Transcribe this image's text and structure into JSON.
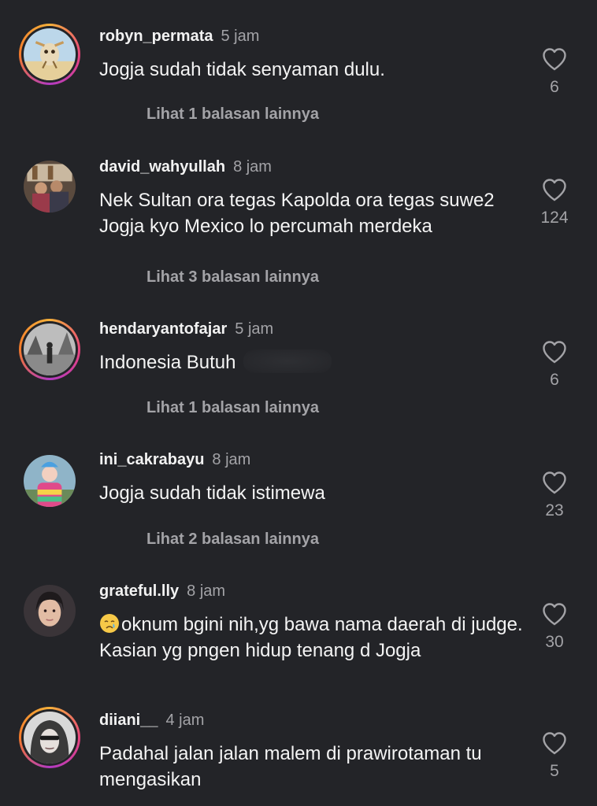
{
  "comments": [
    {
      "username": "robyn_permata",
      "time": "5 jam",
      "text": "Jogja sudah tidak senyaman dulu.",
      "likes": "6",
      "replies": "Lihat 1 balasan lainnya",
      "avatar": "cartoon-character-avatar"
    },
    {
      "username": "david_wahyullah",
      "time": "8 jam",
      "text": "Nek Sultan ora tegas Kapolda ora tegas suwe2 Jogja kyo Mexico lo percumah merdeka",
      "likes": "124",
      "replies": "Lihat 3 balasan lainnya",
      "avatar": "group-photo-avatar"
    },
    {
      "username": "hendaryantofajar",
      "time": "5 jam",
      "text": "Indonesia Butuh",
      "likes": "6",
      "replies": "Lihat 1 balasan lainnya",
      "avatar": "grayscale-photo-avatar"
    },
    {
      "username": "ini_cakrabayu",
      "time": "8 jam",
      "text": "Jogja sudah tidak istimewa",
      "likes": "23",
      "replies": "Lihat 2 balasan lainnya",
      "avatar": "colorful-costume-avatar"
    },
    {
      "username": "grateful.lly",
      "time": "8 jam",
      "text": "oknum bgini nih,yg bawa nama daerah di judge. Kasian yg pngen hidup tenang d Jogja",
      "emoji": "crying-face-emoji",
      "likes": "30",
      "avatar": "selfie-avatar"
    },
    {
      "username": "diiani__",
      "time": "4 jam",
      "text": "Padahal jalan jalan malem di prawirotaman tu mengasikan",
      "likes": "5",
      "avatar": "hooded-portrait-avatar"
    }
  ],
  "colors": {
    "background": "#232428",
    "primary_text": "#f4f4f4",
    "secondary_text": "#a3a3a7"
  },
  "icons": {
    "like": "heart-outline-icon"
  }
}
